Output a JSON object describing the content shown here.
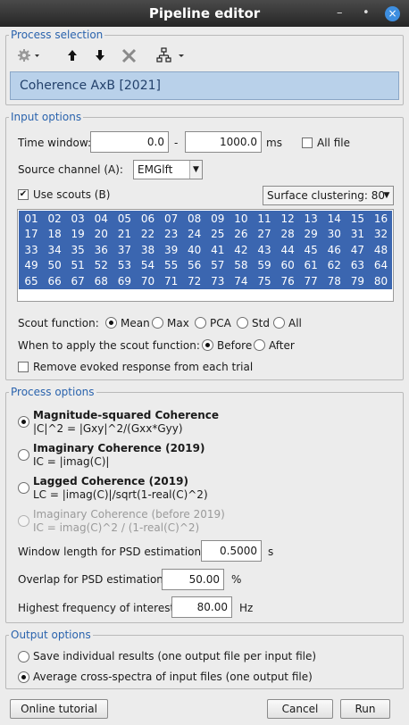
{
  "window": {
    "title": "Pipeline editor",
    "minimize": "–",
    "maximize": "•",
    "close": "×"
  },
  "process_selection": {
    "legend": "Process selection",
    "toolbar": {
      "run_menu_icon": "gear-icon",
      "move_up_icon": "arrow-up-icon",
      "move_down_icon": "arrow-down-icon",
      "delete_icon": "x-icon",
      "pipeline_menu_icon": "tree-icon"
    },
    "selected_process": "Coherence AxB [2021]"
  },
  "input_options": {
    "legend": "Input options",
    "time_window_label": "Time window:",
    "time_start": "0.0",
    "time_separator": "-",
    "time_end": "1000.0",
    "time_unit": "ms",
    "all_file_label": "All file",
    "all_file_checked": false,
    "source_channel_label": "Source channel (A):",
    "source_channel_value": "EMGlft",
    "use_scouts_label": "Use scouts (B)",
    "use_scouts_checked": true,
    "surface_clustering": "Surface clustering: 80",
    "scouts": [
      "01",
      "02",
      "03",
      "04",
      "05",
      "06",
      "07",
      "08",
      "09",
      "10",
      "11",
      "12",
      "13",
      "14",
      "15",
      "16",
      "17",
      "18",
      "19",
      "20",
      "21",
      "22",
      "23",
      "24",
      "25",
      "26",
      "27",
      "28",
      "29",
      "30",
      "31",
      "32",
      "33",
      "34",
      "35",
      "36",
      "37",
      "38",
      "39",
      "40",
      "41",
      "42",
      "43",
      "44",
      "45",
      "46",
      "47",
      "48",
      "49",
      "50",
      "51",
      "52",
      "53",
      "54",
      "55",
      "56",
      "57",
      "58",
      "59",
      "60",
      "61",
      "62",
      "63",
      "64",
      "65",
      "66",
      "67",
      "68",
      "69",
      "70",
      "71",
      "72",
      "73",
      "74",
      "75",
      "76",
      "77",
      "78",
      "79",
      "80"
    ],
    "scout_function_label": "Scout function:",
    "scout_functions": [
      "Mean",
      "Max",
      "PCA",
      "Std",
      "All"
    ],
    "scout_function_selected": "Mean",
    "when_apply_label": "When to apply the scout function:",
    "when_apply_options": [
      "Before",
      "After"
    ],
    "when_apply_selected": "Before",
    "remove_evoked_label": "Remove evoked response from each trial",
    "remove_evoked_checked": false
  },
  "process_options": {
    "legend": "Process options",
    "methods": [
      {
        "title": "Magnitude-squared Coherence",
        "formula": "|C|^2 = |Gxy|^2/(Gxx*Gyy)",
        "selected": true,
        "enabled": true
      },
      {
        "title": "Imaginary Coherence (2019)",
        "formula": "IC = |imag(C)|",
        "selected": false,
        "enabled": true
      },
      {
        "title": "Lagged Coherence (2019)",
        "formula": "LC = |imag(C)|/sqrt(1-real(C)^2)",
        "selected": false,
        "enabled": true
      },
      {
        "title": "Imaginary Coherence (before 2019)",
        "formula": "IC = imag(C)^2 / (1-real(C)^2)",
        "selected": false,
        "enabled": false
      }
    ],
    "window_length_label": "Window length for PSD estimation:",
    "window_length_value": "0.5000",
    "window_length_unit": "s",
    "overlap_label": "Overlap for PSD estimation:",
    "overlap_value": "50.00",
    "overlap_unit": "%",
    "max_freq_label": "Highest frequency of interest:",
    "max_freq_value": "80.00",
    "max_freq_unit": "Hz"
  },
  "output_options": {
    "legend": "Output options",
    "options": [
      "Save individual results (one output file per input file)",
      "Average cross-spectra of input files (one output file)"
    ],
    "selected_index": 1
  },
  "buttons": {
    "tutorial": "Online tutorial",
    "cancel": "Cancel",
    "run": "Run"
  }
}
